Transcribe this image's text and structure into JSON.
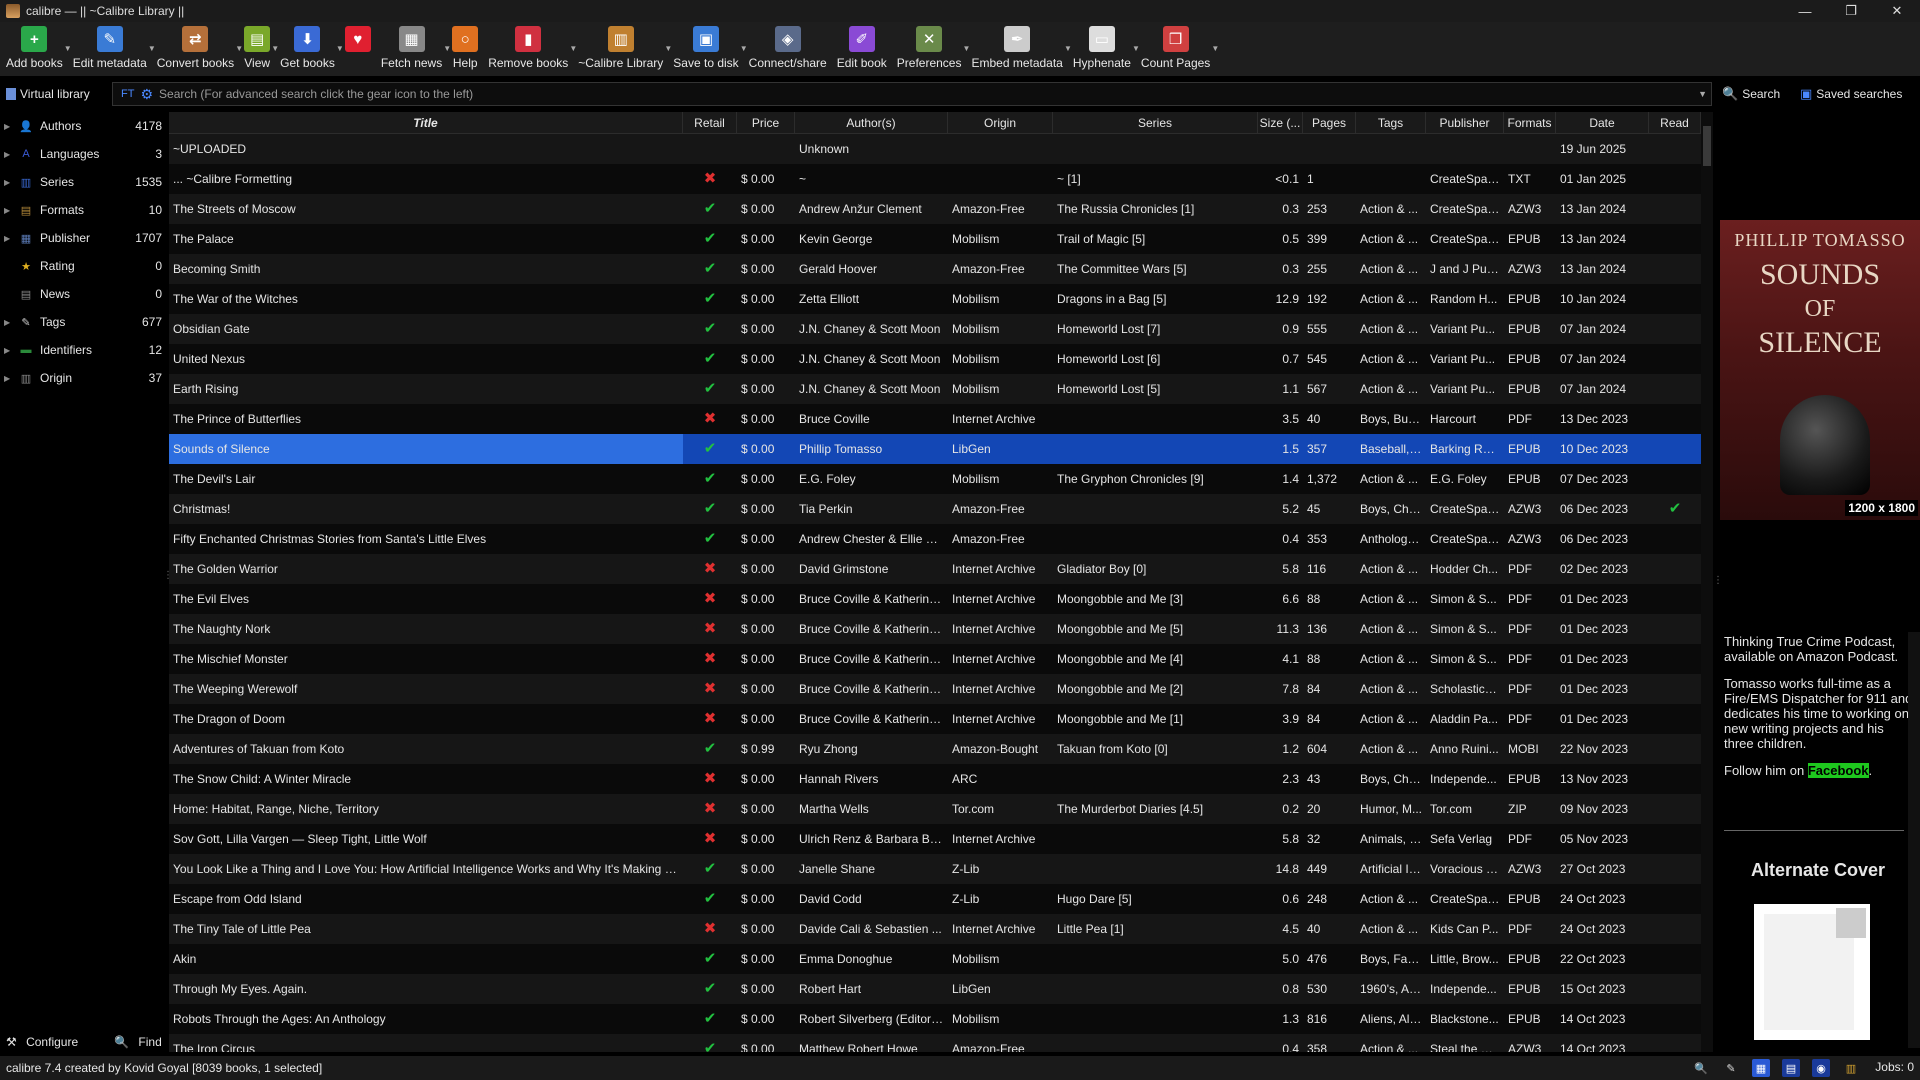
{
  "window": {
    "title": "calibre — || ~Calibre Library ||"
  },
  "toolbar": [
    {
      "name": "add-books",
      "label": "Add books",
      "color": "#2aa84a",
      "glyph": "+",
      "dd": true
    },
    {
      "name": "edit-metadata",
      "label": "Edit metadata",
      "color": "#3a7bd5",
      "glyph": "✎",
      "dd": true
    },
    {
      "name": "convert-books",
      "label": "Convert books",
      "color": "#b5703a",
      "glyph": "⇄",
      "dd": true
    },
    {
      "name": "view",
      "label": "View",
      "color": "#7aa82a",
      "glyph": "▤",
      "dd": true
    },
    {
      "name": "get-books",
      "label": "Get books",
      "color": "#3a6ad5",
      "glyph": "⬇",
      "dd": true
    },
    {
      "name": "donate",
      "label": "",
      "color": "#e02030",
      "glyph": "♥",
      "dd": false
    },
    {
      "name": "fetch-news",
      "label": "Fetch news",
      "color": "#888888",
      "glyph": "▦",
      "dd": true
    },
    {
      "name": "help",
      "label": "Help",
      "color": "#e07020",
      "glyph": "○",
      "dd": false
    },
    {
      "name": "remove-books",
      "label": "Remove books",
      "color": "#d03040",
      "glyph": "▮",
      "dd": true
    },
    {
      "name": "calibre-library",
      "label": "~Calibre Library",
      "color": "#c08030",
      "glyph": "▥",
      "dd": true
    },
    {
      "name": "save-to-disk",
      "label": "Save to disk",
      "color": "#3a7bd5",
      "glyph": "▣",
      "dd": true
    },
    {
      "name": "connect-share",
      "label": "Connect/share",
      "color": "#5a6a8a",
      "glyph": "◈",
      "dd": false
    },
    {
      "name": "edit-book",
      "label": "Edit book",
      "color": "#8a4ad5",
      "glyph": "✐",
      "dd": false
    },
    {
      "name": "preferences",
      "label": "Preferences",
      "color": "#6a8a4a",
      "glyph": "✕",
      "dd": true
    },
    {
      "name": "embed-metadata",
      "label": "Embed metadata",
      "color": "#cccccc",
      "glyph": "✒",
      "dd": true
    },
    {
      "name": "hyphenate",
      "label": "Hyphenate",
      "color": "#dddddd",
      "glyph": "▭",
      "dd": true
    },
    {
      "name": "count-pages",
      "label": "Count Pages",
      "color": "#d04040",
      "glyph": "❒",
      "dd": true
    }
  ],
  "search": {
    "virtual_library": "Virtual library",
    "placeholder": "Search (For advanced search click the gear icon to the left)",
    "search_label": "Search",
    "saved_label": "Saved searches"
  },
  "tag_browser": [
    {
      "name": "authors",
      "label": "Authors",
      "count": "4178",
      "color": "#3a7bd5",
      "glyph": "👤",
      "exp": true
    },
    {
      "name": "languages",
      "label": "Languages",
      "count": "3",
      "color": "#3a5ad5",
      "glyph": "A",
      "exp": true
    },
    {
      "name": "series",
      "label": "Series",
      "count": "1535",
      "color": "#3a6ad5",
      "glyph": "▥",
      "exp": true
    },
    {
      "name": "formats",
      "label": "Formats",
      "count": "10",
      "color": "#b58a3a",
      "glyph": "▤",
      "exp": true
    },
    {
      "name": "publisher",
      "label": "Publisher",
      "count": "1707",
      "color": "#5a7ab5",
      "glyph": "▦",
      "exp": true
    },
    {
      "name": "rating",
      "label": "Rating",
      "count": "0",
      "color": "#e0b020",
      "glyph": "★",
      "exp": false
    },
    {
      "name": "news",
      "label": "News",
      "count": "0",
      "color": "#888888",
      "glyph": "▤",
      "exp": false
    },
    {
      "name": "tags",
      "label": "Tags",
      "count": "677",
      "color": "#cccccc",
      "glyph": "✎",
      "exp": true
    },
    {
      "name": "identifiers",
      "label": "Identifiers",
      "count": "12",
      "color": "#2a8a3a",
      "glyph": "▬",
      "exp": true
    },
    {
      "name": "origin",
      "label": "Origin",
      "count": "37",
      "color": "#888888",
      "glyph": "▥",
      "exp": true
    }
  ],
  "bottom_left": {
    "configure": "Configure",
    "find": "Find"
  },
  "columns": [
    "Title",
    "Retail",
    "Price",
    "Author(s)",
    "Origin",
    "Series",
    "Size (...",
    "Pages",
    "Tags",
    "Publisher",
    "Formats",
    "Date",
    "Read"
  ],
  "rows": [
    {
      "title": "~UPLOADED",
      "retail": "",
      "price": "",
      "author": "Unknown",
      "origin": "",
      "series": "",
      "size": "",
      "pages": "",
      "tags": "",
      "pub": "",
      "fmt": "",
      "date": "19 Jun 2025",
      "read": ""
    },
    {
      "title": "... ~Calibre Formetting",
      "retail": "no",
      "price": "$ 0.00",
      "author": "~",
      "origin": "",
      "series": "~ [1]",
      "size": "<0.1",
      "pages": "1",
      "tags": "",
      "pub": "CreateSpac...",
      "fmt": "TXT",
      "date": "01 Jan 2025",
      "read": ""
    },
    {
      "title": "The Streets of Moscow",
      "retail": "ok",
      "price": "$ 0.00",
      "author": "Andrew Anžur Clement",
      "origin": "Amazon-Free",
      "series": "The Russia Chronicles [1]",
      "size": "0.3",
      "pages": "253",
      "tags": "Action & ...",
      "pub": "CreateSpac...",
      "fmt": "AZW3",
      "date": "13 Jan 2024",
      "read": ""
    },
    {
      "title": "The Palace",
      "retail": "ok",
      "price": "$ 0.00",
      "author": "Kevin George",
      "origin": "Mobilism",
      "series": "Trail of Magic [5]",
      "size": "0.5",
      "pages": "399",
      "tags": "Action & ...",
      "pub": "CreateSpac...",
      "fmt": "EPUB",
      "date": "13 Jan 2024",
      "read": ""
    },
    {
      "title": "Becoming Smith",
      "retail": "ok",
      "price": "$ 0.00",
      "author": "Gerald Hoover",
      "origin": "Amazon-Free",
      "series": "The Committee Wars [5]",
      "size": "0.3",
      "pages": "255",
      "tags": "Action & ...",
      "pub": "J and J Pub...",
      "fmt": "AZW3",
      "date": "13 Jan 2024",
      "read": ""
    },
    {
      "title": "The War of the Witches",
      "retail": "ok",
      "price": "$ 0.00",
      "author": "Zetta Elliott",
      "origin": "Mobilism",
      "series": "Dragons in a Bag [5]",
      "size": "12.9",
      "pages": "192",
      "tags": "Action & ...",
      "pub": "Random H...",
      "fmt": "EPUB",
      "date": "10 Jan 2024",
      "read": ""
    },
    {
      "title": "Obsidian Gate",
      "retail": "ok",
      "price": "$ 0.00",
      "author": "J.N. Chaney & Scott Moon",
      "origin": "Mobilism",
      "series": "Homeworld Lost [7]",
      "size": "0.9",
      "pages": "555",
      "tags": "Action & ...",
      "pub": "Variant Pu...",
      "fmt": "EPUB",
      "date": "07 Jan 2024",
      "read": ""
    },
    {
      "title": "United Nexus",
      "retail": "ok",
      "price": "$ 0.00",
      "author": "J.N. Chaney & Scott Moon",
      "origin": "Mobilism",
      "series": "Homeworld Lost [6]",
      "size": "0.7",
      "pages": "545",
      "tags": "Action & ...",
      "pub": "Variant Pu...",
      "fmt": "EPUB",
      "date": "07 Jan 2024",
      "read": ""
    },
    {
      "title": "Earth Rising",
      "retail": "ok",
      "price": "$ 0.00",
      "author": "J.N. Chaney & Scott Moon",
      "origin": "Mobilism",
      "series": "Homeworld Lost [5]",
      "size": "1.1",
      "pages": "567",
      "tags": "Action & ...",
      "pub": "Variant Pu...",
      "fmt": "EPUB",
      "date": "07 Jan 2024",
      "read": ""
    },
    {
      "title": "The Prince of Butterflies",
      "retail": "no",
      "price": "$ 0.00",
      "author": "Bruce Coville",
      "origin": "Internet Archive",
      "series": "",
      "size": "3.5",
      "pages": "40",
      "tags": "Boys, Butt...",
      "pub": "Harcourt",
      "fmt": "PDF",
      "date": "13 Dec 2023",
      "read": ""
    },
    {
      "title": "Sounds of Silence",
      "retail": "ok",
      "price": "$ 0.00",
      "author": "Phillip Tomasso",
      "origin": "LibGen",
      "series": "",
      "size": "1.5",
      "pages": "357",
      "tags": "Baseball, B...",
      "pub": "Barking Rai...",
      "fmt": "EPUB",
      "date": "10 Dec 2023",
      "read": "",
      "sel": true
    },
    {
      "title": "The Devil's Lair",
      "retail": "ok",
      "price": "$ 0.00",
      "author": "E.G. Foley",
      "origin": "Mobilism",
      "series": "The Gryphon Chronicles [9]",
      "size": "1.4",
      "pages": "1,372",
      "tags": "Action & ...",
      "pub": "E.G. Foley",
      "fmt": "EPUB",
      "date": "07 Dec 2023",
      "read": ""
    },
    {
      "title": "Christmas!",
      "retail": "ok",
      "price": "$ 0.00",
      "author": "Tia Perkin",
      "origin": "Amazon-Free",
      "series": "",
      "size": "5.2",
      "pages": "45",
      "tags": "Boys, Chil...",
      "pub": "CreateSpac...",
      "fmt": "AZW3",
      "date": "06 Dec 2023",
      "read": "ok"
    },
    {
      "title": "Fifty Enchanted Christmas Stories from Santa's Little Elves",
      "retail": "ok",
      "price": "$ 0.00",
      "author": "Andrew Chester & Ellie C...",
      "origin": "Amazon-Free",
      "series": "",
      "size": "0.4",
      "pages": "353",
      "tags": "Anthology...",
      "pub": "CreateSpac...",
      "fmt": "AZW3",
      "date": "06 Dec 2023",
      "read": ""
    },
    {
      "title": "The Golden Warrior",
      "retail": "no",
      "price": "$ 0.00",
      "author": "David Grimstone",
      "origin": "Internet Archive",
      "series": "Gladiator Boy [0]",
      "size": "5.8",
      "pages": "116",
      "tags": "Action & ...",
      "pub": "Hodder Ch...",
      "fmt": "PDF",
      "date": "02 Dec 2023",
      "read": ""
    },
    {
      "title": "The Evil Elves",
      "retail": "no",
      "price": "$ 0.00",
      "author": "Bruce Coville & Katherine...",
      "origin": "Internet Archive",
      "series": "Moongobble and Me [3]",
      "size": "6.6",
      "pages": "88",
      "tags": "Action & ...",
      "pub": "Simon & S...",
      "fmt": "PDF",
      "date": "01 Dec 2023",
      "read": ""
    },
    {
      "title": "The Naughty Nork",
      "retail": "no",
      "price": "$ 0.00",
      "author": "Bruce Coville & Katherine...",
      "origin": "Internet Archive",
      "series": "Moongobble and Me [5]",
      "size": "11.3",
      "pages": "136",
      "tags": "Action & ...",
      "pub": "Simon & S...",
      "fmt": "PDF",
      "date": "01 Dec 2023",
      "read": ""
    },
    {
      "title": "The Mischief Monster",
      "retail": "no",
      "price": "$ 0.00",
      "author": "Bruce Coville & Katherine...",
      "origin": "Internet Archive",
      "series": "Moongobble and Me [4]",
      "size": "4.1",
      "pages": "88",
      "tags": "Action & ...",
      "pub": "Simon & S...",
      "fmt": "PDF",
      "date": "01 Dec 2023",
      "read": ""
    },
    {
      "title": "The Weeping Werewolf",
      "retail": "no",
      "price": "$ 0.00",
      "author": "Bruce Coville & Katherine...",
      "origin": "Internet Archive",
      "series": "Moongobble and Me [2]",
      "size": "7.8",
      "pages": "84",
      "tags": "Action & ...",
      "pub": "Scholastic I...",
      "fmt": "PDF",
      "date": "01 Dec 2023",
      "read": ""
    },
    {
      "title": "The Dragon of Doom",
      "retail": "no",
      "price": "$ 0.00",
      "author": "Bruce Coville & Katherine...",
      "origin": "Internet Archive",
      "series": "Moongobble and Me [1]",
      "size": "3.9",
      "pages": "84",
      "tags": "Action & ...",
      "pub": "Aladdin Pa...",
      "fmt": "PDF",
      "date": "01 Dec 2023",
      "read": ""
    },
    {
      "title": "Adventures of Takuan from Koto",
      "retail": "ok",
      "price": "$ 0.99",
      "author": "Ryu Zhong",
      "origin": "Amazon-Bought",
      "series": "Takuan from Koto [0]",
      "size": "1.2",
      "pages": "604",
      "tags": "Action & ...",
      "pub": "Anno Ruini...",
      "fmt": "MOBI",
      "date": "22 Nov 2023",
      "read": ""
    },
    {
      "title": "The Snow Child: A Winter Miracle",
      "retail": "no",
      "price": "$ 0.00",
      "author": "Hannah Rivers",
      "origin": "ARC",
      "series": "",
      "size": "2.3",
      "pages": "43",
      "tags": "Boys, Chil...",
      "pub": "Independe...",
      "fmt": "EPUB",
      "date": "13 Nov 2023",
      "read": ""
    },
    {
      "title": "Home: Habitat, Range, Niche, Territory",
      "retail": "no",
      "price": "$ 0.00",
      "author": "Martha Wells",
      "origin": "Tor.com",
      "series": "The Murderbot Diaries [4.5]",
      "size": "0.2",
      "pages": "20",
      "tags": "Humor, M...",
      "pub": "Tor.com",
      "fmt": "ZIP",
      "date": "09 Nov 2023",
      "read": ""
    },
    {
      "title": "Sov Gott, Lilla Vargen — Sleep Tight, Little Wolf",
      "retail": "no",
      "price": "$ 0.00",
      "author": "Ulrich Renz & Barbara Bri...",
      "origin": "Internet Archive",
      "series": "",
      "size": "5.8",
      "pages": "32",
      "tags": "Animals, B...",
      "pub": "Sefa Verlag",
      "fmt": "PDF",
      "date": "05 Nov 2023",
      "read": ""
    },
    {
      "title": "You Look Like a Thing and I Love You: How Artificial Intelligence Works and Why It's Making th...",
      "retail": "ok",
      "price": "$ 0.00",
      "author": "Janelle Shane",
      "origin": "Z-Lib",
      "series": "",
      "size": "14.8",
      "pages": "449",
      "tags": "Artificial In...",
      "pub": "Voracious (...",
      "fmt": "AZW3",
      "date": "27 Oct 2023",
      "read": ""
    },
    {
      "title": "Escape from Odd Island",
      "retail": "ok",
      "price": "$ 0.00",
      "author": "David Codd",
      "origin": "Z-Lib",
      "series": "Hugo Dare [5]",
      "size": "0.6",
      "pages": "248",
      "tags": "Action & ...",
      "pub": "CreateSpac...",
      "fmt": "EPUB",
      "date": "24 Oct 2023",
      "read": ""
    },
    {
      "title": "The Tiny Tale of Little Pea",
      "retail": "no",
      "price": "$ 0.00",
      "author": "Davide Cali & Sebastien ...",
      "origin": "Internet Archive",
      "series": "Little Pea [1]",
      "size": "4.5",
      "pages": "40",
      "tags": "Action & ...",
      "pub": "Kids Can P...",
      "fmt": "PDF",
      "date": "24 Oct 2023",
      "read": ""
    },
    {
      "title": "Akin",
      "retail": "ok",
      "price": "$ 0.00",
      "author": "Emma Donoghue",
      "origin": "Mobilism",
      "series": "",
      "size": "5.0",
      "pages": "476",
      "tags": "Boys, Fami...",
      "pub": "Little, Brow...",
      "fmt": "EPUB",
      "date": "22 Oct 2023",
      "read": ""
    },
    {
      "title": "Through My Eyes. Again.",
      "retail": "ok",
      "price": "$ 0.00",
      "author": "Robert Hart",
      "origin": "LibGen",
      "series": "",
      "size": "0.8",
      "pages": "530",
      "tags": "1960's, Ab...",
      "pub": "Independe...",
      "fmt": "EPUB",
      "date": "15 Oct 2023",
      "read": ""
    },
    {
      "title": "Robots Through the Ages: An Anthology",
      "retail": "ok",
      "price": "$ 0.00",
      "author": "Robert Silverberg (Editor) ...",
      "origin": "Mobilism",
      "series": "",
      "size": "1.3",
      "pages": "816",
      "tags": "Aliens, Alt...",
      "pub": "Blackstone...",
      "fmt": "EPUB",
      "date": "14 Oct 2023",
      "read": ""
    },
    {
      "title": "The Iron Circus",
      "retail": "ok",
      "price": "$ 0.00",
      "author": "Matthew Robert Howe",
      "origin": "Amazon-Free",
      "series": "",
      "size": "0.4",
      "pages": "358",
      "tags": "Action & ...",
      "pub": "Steal the M...",
      "fmt": "AZW3",
      "date": "14 Oct 2023",
      "read": ""
    }
  ],
  "details": {
    "cover_author": "PHILLIP TOMASSO",
    "cover_title_1": "SOUNDS",
    "cover_title_2": "OF",
    "cover_title_3": "SILENCE",
    "cover_dims": "1200 x 1800",
    "bio_1": "Thinking True Crime Podcast, available on Amazon Podcast.",
    "bio_2": "Tomasso works full-time as a Fire/EMS Dispatcher for 911 and dedicates his time to working on new writing projects and his three children.",
    "bio_3_pre": "Follow him on ",
    "bio_3_link": "Facebook",
    "bio_3_post": ".",
    "alt_cover": "Alternate Cover"
  },
  "status": {
    "text": "calibre 7.4 created by Kovid Goyal   [8039 books, 1 selected]",
    "jobs": "Jobs: 0"
  }
}
